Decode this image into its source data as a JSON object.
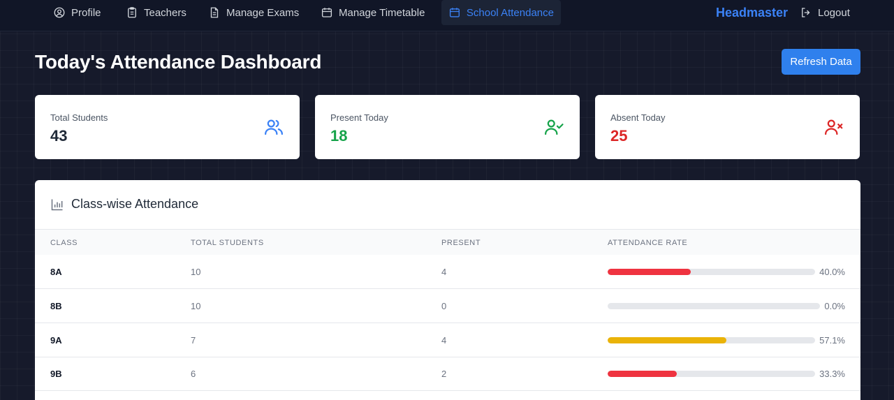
{
  "nav": {
    "items": [
      {
        "label": "Profile",
        "icon": "user-circle-icon"
      },
      {
        "label": "Teachers",
        "icon": "clipboard-icon"
      },
      {
        "label": "Manage Exams",
        "icon": "document-icon"
      },
      {
        "label": "Manage Timetable",
        "icon": "calendar-icon"
      },
      {
        "label": "School Attendance",
        "icon": "calendar-icon",
        "active": true
      }
    ],
    "brand": "Headmaster",
    "logout": "Logout"
  },
  "page": {
    "title": "Today's Attendance Dashboard",
    "refresh_label": "Refresh Data"
  },
  "stats": {
    "total": {
      "label": "Total Students",
      "value": "43",
      "icon": "users-icon",
      "color": "#3b82f6"
    },
    "present": {
      "label": "Present Today",
      "value": "18",
      "icon": "user-check-icon",
      "color": "#16a34a"
    },
    "absent": {
      "label": "Absent Today",
      "value": "25",
      "icon": "user-x-icon",
      "color": "#dc2626"
    }
  },
  "table": {
    "title": "Class-wise Attendance",
    "icon": "bar-chart-icon",
    "columns": [
      "Class",
      "Total Students",
      "Present",
      "Attendance Rate"
    ],
    "rows": [
      {
        "class": "8A",
        "total": "10",
        "present": "4",
        "rate": 0.4,
        "rate_label": "40.0%",
        "color": "#ef3340"
      },
      {
        "class": "8B",
        "total": "10",
        "present": "0",
        "rate": 0.0,
        "rate_label": "0.0%",
        "color": "#ef3340"
      },
      {
        "class": "9A",
        "total": "7",
        "present": "4",
        "rate": 0.571,
        "rate_label": "57.1%",
        "color": "#eab308"
      },
      {
        "class": "9B",
        "total": "6",
        "present": "2",
        "rate": 0.333,
        "rate_label": "33.3%",
        "color": "#ef3340"
      }
    ]
  }
}
